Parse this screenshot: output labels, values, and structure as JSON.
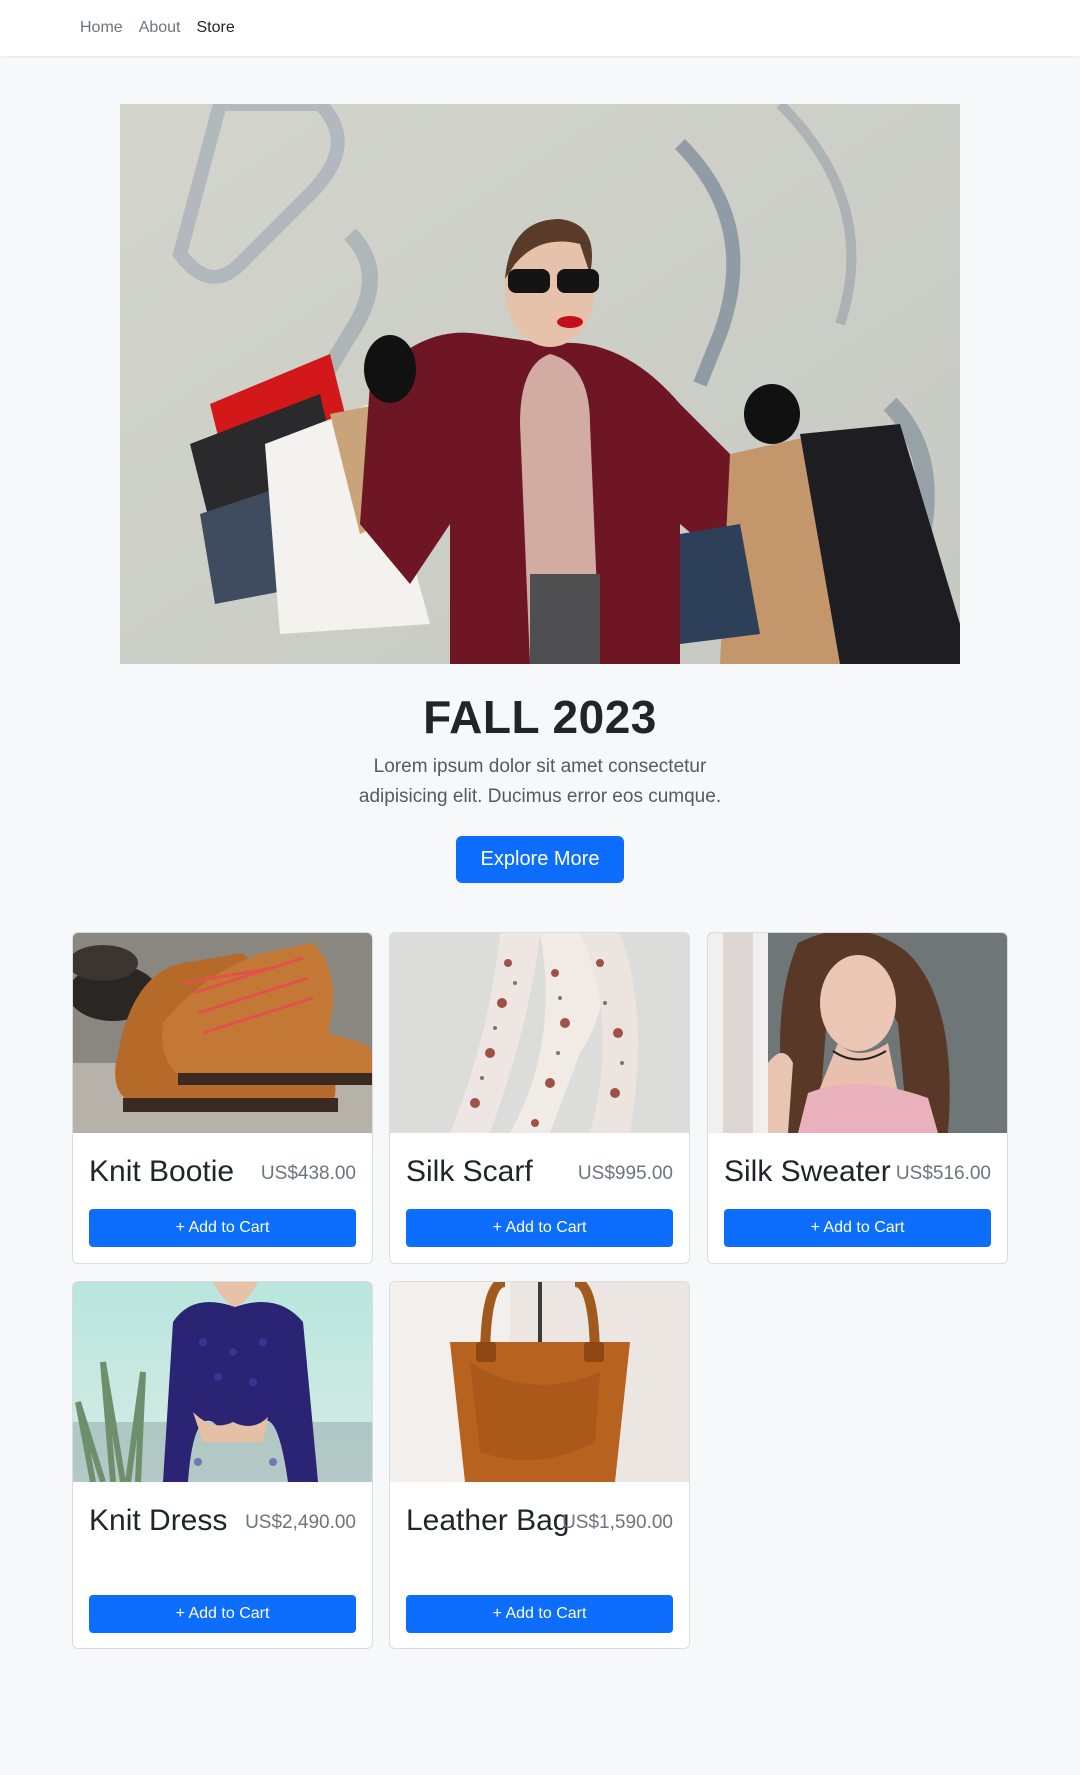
{
  "nav": {
    "items": [
      {
        "label": "Home"
      },
      {
        "label": "About"
      },
      {
        "label": "Store"
      }
    ]
  },
  "hero": {
    "title": "FALL 2023",
    "text": "Lorem ipsum dolor sit amet consectetur adipisicing elit. Ducimus error eos cumque.",
    "button": "Explore More"
  },
  "products": [
    {
      "name": "Knit Bootie",
      "price": "US$438.00",
      "button": "+ Add to Cart",
      "image": "boots-photo"
    },
    {
      "name": "Silk Scarf",
      "price": "US$995.00",
      "button": "+ Add to Cart",
      "image": "scarf-photo"
    },
    {
      "name": "Silk Sweater",
      "price": "US$516.00",
      "button": "+ Add to Cart",
      "image": "sweater-photo"
    },
    {
      "name": "Knit Dress",
      "price": "US$2,490.00",
      "button": "+ Add to Cart",
      "image": "dress-photo"
    },
    {
      "name": "Leather Bag",
      "price": "US$1,590.00",
      "button": "+ Add to Cart",
      "image": "bag-photo"
    }
  ],
  "colors": {
    "primary": "#0d6efd",
    "background": "#f7f8fa",
    "muted": "#6c757d"
  }
}
